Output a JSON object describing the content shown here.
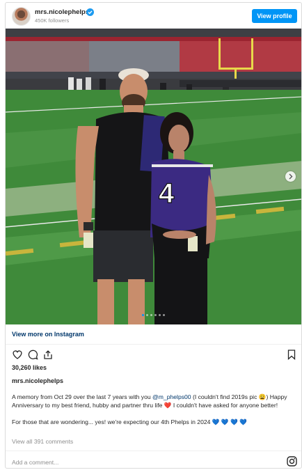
{
  "header": {
    "username": "mrs.nicolephelps",
    "followers": "450K followers",
    "view_profile_label": "View profile",
    "verified_icon": "verified-badge-icon",
    "accent_color": "#0095f6"
  },
  "post": {
    "photo_icon": "photo-carousel",
    "carousel": {
      "slide_count": 6,
      "active_slide": 1,
      "next_icon": "chevron-right-icon"
    },
    "view_more_label": "View more on Instagram",
    "action_icons": [
      "heart-icon",
      "comment-icon",
      "share-icon",
      "bookmark-icon"
    ],
    "likes": "30,260 likes",
    "caption_user": "mrs.nicolephelps",
    "caption_part1": "A memory from Oct 29 over the last 7 years with you ",
    "caption_mention": "@m_phelps00",
    "caption_part2": " (I couldn't find 2019s pic 😩) Happy Anniversary to my best friend, hubby and partner thru life ",
    "caption_heart": "❤️",
    "caption_part3": " I couldn't have asked for anyone better!",
    "caption_line2": "For those that are wondering... yes! we're expecting our 4th Phelps in 2024 ",
    "caption_blue_hearts": "💙 💙 💙 💙",
    "view_comments": "View all 391 comments",
    "add_comment_placeholder": "Add a comment...",
    "instagram_icon": "instagram-logo-icon"
  }
}
